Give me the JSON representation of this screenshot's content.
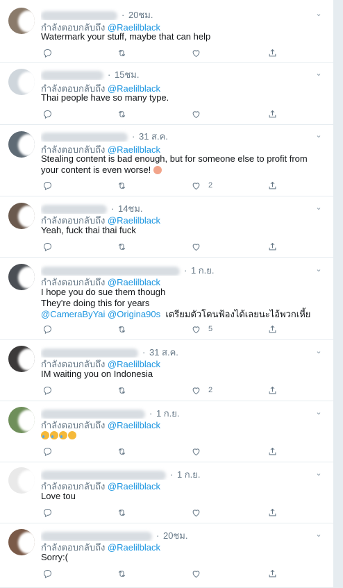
{
  "reply_prefix": "กำลังตอบกลับถึง",
  "reply_handle": "@Raelilblack",
  "tweets": [
    {
      "time": "20ชม.",
      "body": "Watermark your stuff, maybe that can help",
      "likes": "",
      "retweets": ""
    },
    {
      "time": "15ชม.",
      "body": "Thai people have so many type.",
      "likes": "",
      "retweets": ""
    },
    {
      "time": "31 ส.ค.",
      "body": "Stealing content is bad enough, but for someone else to profit from\nyour content is even worse!",
      "likes": "2",
      "retweets": ""
    },
    {
      "time": "14ชม.",
      "body": "Yeah, fuck thai thai fuck",
      "likes": "",
      "retweets": ""
    },
    {
      "time": "1 ก.ย.",
      "body_line1": "I hope you do sue them though",
      "body_line2": "They're doing this for years",
      "mentions": "@CameraByYai @Origina90s",
      "body_thai": "เตรียมตัวโดนฟ้องได้เลยนะไอ้พวกเหี้ย",
      "likes": "5",
      "retweets": ""
    },
    {
      "time": "31 ส.ค.",
      "body": "IM waiting you on Indonesia",
      "likes": "2",
      "retweets": ""
    },
    {
      "time": "1 ก.ย.",
      "body": "",
      "likes": "",
      "retweets": ""
    },
    {
      "time": "1 ก.ย.",
      "body": "Love tou",
      "likes": "",
      "retweets": ""
    },
    {
      "time": "20ชม.",
      "body": "Sorry:(",
      "likes": "",
      "retweets": ""
    }
  ],
  "colors": {
    "link": "#1b95e0",
    "muted": "#657786",
    "text": "#14171a",
    "divider": "#e6ecf0"
  },
  "icons": {
    "reply": "reply-icon",
    "retweet": "retweet-icon",
    "like": "heart-icon",
    "share": "share-icon",
    "menu": "chevron-down-icon"
  }
}
